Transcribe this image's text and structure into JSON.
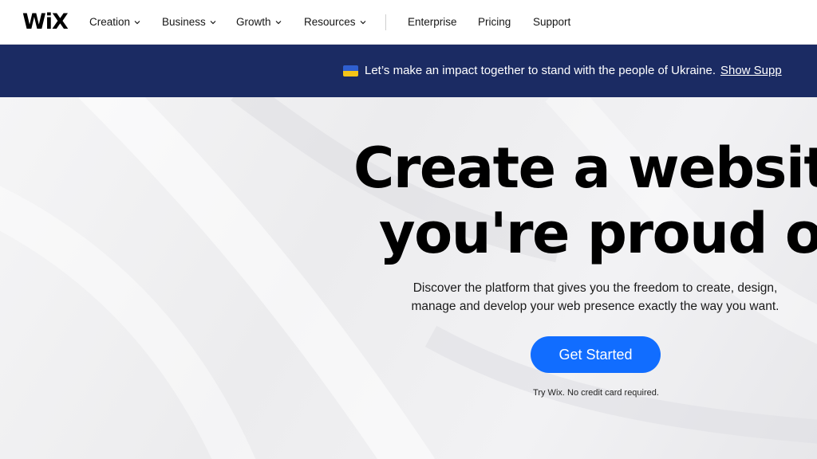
{
  "brand": {
    "logo_text": "WiX"
  },
  "nav": {
    "items": [
      {
        "label": "Creation",
        "has_dropdown": true
      },
      {
        "label": "Business",
        "has_dropdown": true
      },
      {
        "label": "Growth",
        "has_dropdown": true
      },
      {
        "label": "Resources",
        "has_dropdown": true
      },
      {
        "label": "Enterprise",
        "has_dropdown": false
      },
      {
        "label": "Pricing",
        "has_dropdown": false
      },
      {
        "label": "Support",
        "has_dropdown": false
      }
    ]
  },
  "banner": {
    "flag_icon": "ukraine-flag-icon",
    "text": "Let’s make an impact together to stand with the people of Ukraine.",
    "link_label": "Show Supp"
  },
  "hero": {
    "headline_line1": "Create a website",
    "headline_line2": "you're proud of",
    "subtitle_line1": "Discover the platform that gives you the freedom to create, design,",
    "subtitle_line2": "manage and develop your web presence exactly the way you want.",
    "cta_label": "Get Started",
    "note": "Try Wix. No credit card required."
  },
  "colors": {
    "banner_bg": "#1b2b63",
    "cta_bg": "#116dff",
    "text": "#000000"
  }
}
